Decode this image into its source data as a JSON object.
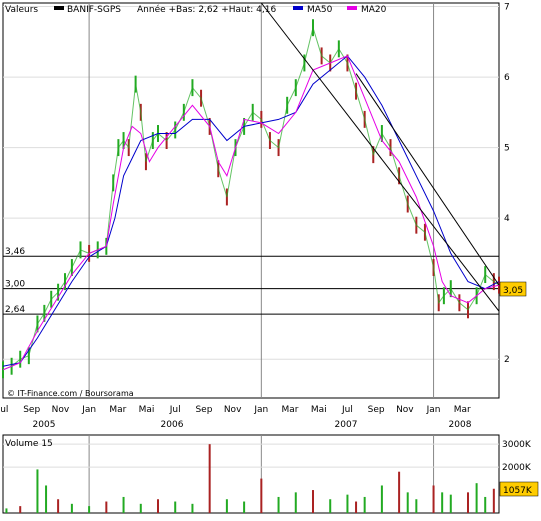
{
  "chart_data": [
    {
      "type": "line",
      "legend": {
        "valeurs_label": "Valeurs",
        "ticker": "BANIF-SGPS",
        "stats": "Année +Bas: 2,62 +Haut: 4,16",
        "ma50_label": "MA50",
        "ma20_label": "MA20",
        "colors": {
          "price": "#000000",
          "ma50": "#0000cc",
          "ma20": "#e600e6",
          "up": "#22aa22",
          "down": "#aa2222"
        }
      },
      "y_ticks": [
        {
          "value": 2,
          "label": "2"
        },
        {
          "value": 3,
          "label": "3"
        },
        {
          "value": 4,
          "label": "4"
        },
        {
          "value": 5,
          "label": "5"
        },
        {
          "value": 6,
          "label": "6"
        },
        {
          "value": 7,
          "label": "7"
        }
      ],
      "ylim": [
        1.45,
        7.05
      ],
      "x_month_labels": [
        "Jul",
        "Sep",
        "Nov",
        "Jan",
        "Mar",
        "Mai",
        "Jul",
        "Sep",
        "Nov",
        "Jan",
        "Mar",
        "Mai",
        "Jul",
        "Sep",
        "Nov",
        "Jan",
        "Mar"
      ],
      "x_year_labels": [
        "2005",
        "2006",
        "2007",
        "2008"
      ],
      "xlim": [
        2005.5,
        2008.38
      ],
      "year_separators": [
        2006.0,
        2007.0,
        2008.0
      ],
      "h_levels": [
        {
          "value": 3.46,
          "label": "3,46"
        },
        {
          "value": 3.0,
          "label": "3,00"
        },
        {
          "value": 2.64,
          "label": "2,64"
        }
      ],
      "current_value_label": "3,05",
      "current_value": 3.05,
      "source_label": "© IT-Finance.com / Boursorama",
      "price_series": {
        "name": "BANIF-SGPS",
        "x": [
          2005.5,
          2005.55,
          2005.6,
          2005.65,
          2005.7,
          2005.74,
          2005.78,
          2005.82,
          2005.86,
          2005.9,
          2005.95,
          2006.0,
          2006.05,
          2006.1,
          2006.14,
          2006.17,
          2006.2,
          2006.23,
          2006.27,
          2006.3,
          2006.33,
          2006.37,
          2006.4,
          2006.45,
          2006.5,
          2006.55,
          2006.6,
          2006.65,
          2006.7,
          2006.75,
          2006.8,
          2006.85,
          2006.9,
          2006.95,
          2007.0,
          2007.05,
          2007.1,
          2007.15,
          2007.2,
          2007.25,
          2007.3,
          2007.35,
          2007.4,
          2007.45,
          2007.5,
          2007.55,
          2007.6,
          2007.65,
          2007.7,
          2007.75,
          2007.8,
          2007.85,
          2007.9,
          2007.95,
          2008.0,
          2008.03,
          2008.06,
          2008.1,
          2008.15,
          2008.2,
          2008.25,
          2008.3,
          2008.35,
          2008.38
        ],
        "y": [
          1.85,
          1.9,
          2.0,
          2.05,
          2.5,
          2.65,
          2.85,
          2.95,
          3.1,
          3.3,
          3.55,
          3.5,
          3.55,
          3.6,
          4.5,
          5.0,
          5.1,
          5.0,
          5.9,
          5.5,
          4.8,
          5.1,
          5.2,
          5.1,
          5.25,
          5.5,
          5.85,
          5.7,
          5.3,
          4.7,
          4.3,
          5.0,
          5.3,
          5.5,
          5.4,
          5.1,
          5.0,
          5.6,
          5.85,
          6.2,
          6.7,
          6.3,
          6.2,
          6.4,
          6.2,
          5.8,
          5.4,
          4.9,
          5.2,
          5.0,
          4.6,
          4.2,
          3.9,
          3.8,
          3.3,
          2.8,
          2.9,
          3.0,
          2.8,
          2.7,
          2.9,
          3.2,
          3.1,
          3.05
        ]
      },
      "ma50_series": {
        "name": "MA50",
        "x": [
          2005.5,
          2005.6,
          2005.7,
          2005.8,
          2005.9,
          2006.0,
          2006.1,
          2006.15,
          2006.2,
          2006.3,
          2006.4,
          2006.5,
          2006.6,
          2006.7,
          2006.8,
          2006.9,
          2007.0,
          2007.1,
          2007.2,
          2007.3,
          2007.4,
          2007.5,
          2007.6,
          2007.7,
          2007.8,
          2007.9,
          2008.0,
          2008.1,
          2008.2,
          2008.3,
          2008.38
        ],
        "y": [
          1.9,
          1.95,
          2.3,
          2.7,
          3.1,
          3.45,
          3.6,
          4.0,
          4.6,
          5.1,
          5.2,
          5.2,
          5.4,
          5.4,
          5.1,
          5.3,
          5.35,
          5.4,
          5.5,
          5.9,
          6.1,
          6.3,
          6.0,
          5.6,
          5.1,
          4.6,
          4.1,
          3.5,
          3.1,
          3.0,
          3.1
        ]
      },
      "ma20_series": {
        "name": "MA20",
        "x": [
          2005.5,
          2005.6,
          2005.7,
          2005.8,
          2005.9,
          2006.0,
          2006.1,
          2006.14,
          2006.2,
          2006.25,
          2006.3,
          2006.35,
          2006.4,
          2006.5,
          2006.6,
          2006.7,
          2006.75,
          2006.8,
          2006.85,
          2006.9,
          2007.0,
          2007.1,
          2007.2,
          2007.3,
          2007.4,
          2007.5,
          2007.6,
          2007.7,
          2007.8,
          2007.9,
          2008.0,
          2008.05,
          2008.1,
          2008.2,
          2008.3,
          2008.38
        ],
        "y": [
          1.85,
          1.95,
          2.4,
          2.8,
          3.2,
          3.5,
          3.6,
          4.2,
          5.0,
          5.3,
          5.2,
          4.8,
          5.0,
          5.3,
          5.6,
          5.3,
          4.8,
          4.6,
          5.0,
          5.4,
          5.35,
          5.2,
          5.5,
          6.1,
          6.2,
          6.3,
          5.7,
          5.1,
          4.8,
          4.3,
          3.6,
          3.1,
          2.9,
          2.8,
          3.0,
          3.05
        ]
      },
      "trendlines": [
        {
          "x": [
            2007.0,
            2008.38
          ],
          "y": [
            7.05,
            2.68
          ]
        },
        {
          "x": [
            2007.55,
            2008.38
          ],
          "y": [
            6.05,
            3.05
          ]
        }
      ]
    },
    {
      "type": "bar",
      "title": "Volume 15",
      "y_ticks": [
        {
          "value": 3000,
          "label": "3000K"
        },
        {
          "value": 2000,
          "label": "2000K"
        }
      ],
      "ylim": [
        0,
        3400
      ],
      "current_value_label": "1057K",
      "current_value": 1057,
      "x": [
        2005.52,
        2005.6,
        2005.7,
        2005.75,
        2005.82,
        2005.9,
        2006.0,
        2006.1,
        2006.2,
        2006.3,
        2006.4,
        2006.5,
        2006.6,
        2006.7,
        2006.8,
        2006.9,
        2007.0,
        2007.1,
        2007.2,
        2007.3,
        2007.4,
        2007.5,
        2007.55,
        2007.6,
        2007.7,
        2007.8,
        2007.85,
        2007.9,
        2008.0,
        2008.05,
        2008.1,
        2008.2,
        2008.25,
        2008.3,
        2008.35
      ],
      "values": [
        200,
        300,
        1900,
        1200,
        600,
        400,
        300,
        500,
        700,
        400,
        600,
        500,
        400,
        3000,
        600,
        500,
        1500,
        700,
        900,
        1000,
        600,
        800,
        500,
        700,
        1200,
        1800,
        900,
        600,
        1200,
        900,
        800,
        900,
        1300,
        700,
        1057
      ]
    }
  ]
}
